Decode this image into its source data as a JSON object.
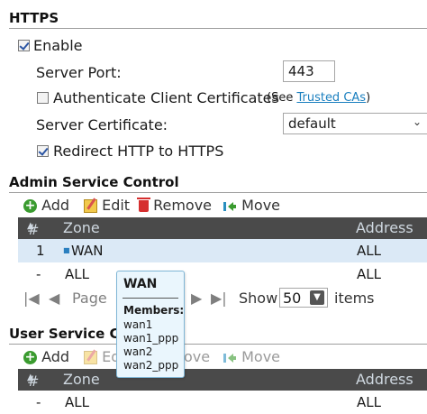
{
  "https": {
    "title": "HTTPS",
    "enable_label": "Enable",
    "enable_checked": true,
    "server_port_label": "Server Port:",
    "server_port_value": "443",
    "auth_client_label": "Authenticate Client Certificates",
    "auth_client_checked": false,
    "see_prefix": "(See ",
    "trusted_cas_link": "Trusted CAs",
    "see_suffix": ")",
    "server_cert_label": "Server Certificate:",
    "server_cert_value": "default",
    "redirect_label": "Redirect HTTP to HTTPS",
    "redirect_checked": true
  },
  "admin_service": {
    "title": "Admin Service Control",
    "toolbar": {
      "add": "Add",
      "edit": "Edit",
      "remove": "Remove",
      "move": "Move"
    },
    "columns": {
      "num": "#",
      "zone": "Zone",
      "address": "Address"
    },
    "rows": [
      {
        "num": "1",
        "zone": "WAN",
        "address": "ALL"
      },
      {
        "num": "-",
        "zone": "ALL",
        "address": "ALL"
      }
    ],
    "pager": {
      "page_label": "Page",
      "show_label": "Show",
      "per_page": "50",
      "items_label": "items"
    }
  },
  "tooltip": {
    "title": "WAN",
    "members_label": "Members:",
    "members": [
      "wan1",
      "wan1_ppp",
      "wan2",
      "wan2_ppp"
    ]
  },
  "user_service": {
    "title": "User Service Con",
    "toolbar": {
      "add": "Add",
      "edit": "Ed",
      "remove": "ove",
      "move": "Move"
    },
    "columns": {
      "num": "#",
      "zone": "Zone",
      "address": "Address"
    },
    "rows": [
      {
        "num": "-",
        "zone": "ALL",
        "address": "ALL"
      }
    ]
  },
  "colors": {
    "header_bg": "#4a4a4a",
    "selected_row": "#dbe9f6",
    "link": "#1a7fbf",
    "tooltip_bg": "#eaf6fd"
  }
}
